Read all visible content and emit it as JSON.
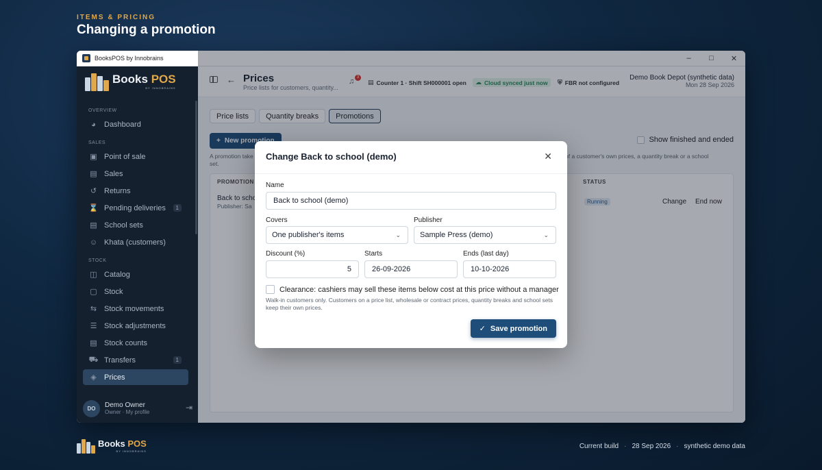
{
  "header": {
    "kicker": "ITEMS & PRICING",
    "title": "Changing a promotion"
  },
  "window": {
    "title": "BooksPOS by Innobrains",
    "controls": [
      "minimize-icon",
      "maximize-icon",
      "close-icon"
    ]
  },
  "brand": {
    "books": "Books",
    "pos": "POS",
    "sub": "BY INNOBRAINS",
    "color_accent": "#e0a84a"
  },
  "sidebar": {
    "sections": {
      "overview": "OVERVIEW",
      "sales": "SALES",
      "stock": "STOCK"
    },
    "items": [
      {
        "label": "Dashboard",
        "icon": "gauge-icon"
      },
      {
        "label": "Point of sale",
        "icon": "scan-icon"
      },
      {
        "label": "Sales",
        "icon": "receipt-icon"
      },
      {
        "label": "Returns",
        "icon": "undo-icon"
      },
      {
        "label": "Pending deliveries",
        "icon": "hourglass-icon",
        "badge": "1"
      },
      {
        "label": "School sets",
        "icon": "backpack-icon"
      },
      {
        "label": "Khata (customers)",
        "icon": "users-icon"
      },
      {
        "label": "Catalog",
        "icon": "book-icon"
      },
      {
        "label": "Stock",
        "icon": "box-icon"
      },
      {
        "label": "Stock movements",
        "icon": "arrows-icon"
      },
      {
        "label": "Stock adjustments",
        "icon": "sliders-icon"
      },
      {
        "label": "Stock counts",
        "icon": "clipboard-icon"
      },
      {
        "label": "Transfers",
        "icon": "truck-icon",
        "badge": "1"
      },
      {
        "label": "Prices",
        "icon": "tag-icon",
        "active": true
      }
    ],
    "user": {
      "initials": "DO",
      "name": "Demo Owner",
      "sub": "Owner · My profile"
    }
  },
  "topbar": {
    "title": "Prices",
    "subtitle": "Price lists for customers, quantity...",
    "notifications": "3",
    "counter": "Counter 1 · Shift SH000001 open",
    "cloud": "Cloud synced just now",
    "fbr": "FBR not configured",
    "org": "Demo Book Depot (synthetic data)",
    "date": "Mon 28 Sep 2026"
  },
  "tabs": [
    "Price lists",
    "Quantity breaks",
    "Promotions"
  ],
  "toolbar": {
    "new_label": "New promotion",
    "show_finished": "Show finished and ended",
    "hint_left": "A promotion take set.",
    "hint_right": "of a customer's own prices, a quantity break or a school"
  },
  "table": {
    "headers": {
      "promotion": "PROMOTION",
      "status": "STATUS"
    },
    "rows": [
      {
        "name": "Back to scho",
        "sub": "Publisher: Sa",
        "status": "Running",
        "change": "Change",
        "end": "End now"
      }
    ]
  },
  "modal": {
    "title": "Change Back to school (demo)",
    "name_label": "Name",
    "name_value": "Back to school (demo)",
    "covers_label": "Covers",
    "covers_value": "One publisher's items",
    "publisher_label": "Publisher",
    "publisher_value": "Sample Press (demo)",
    "discount_label": "Discount (%)",
    "discount_value": "5",
    "starts_label": "Starts",
    "starts_value": "26-09-2026",
    "ends_label": "Ends (last day)",
    "ends_value": "10-10-2026",
    "clearance_label": "Clearance: cashiers may sell these items below cost at this price without a manager",
    "clearance_checked": false,
    "clearance_hint": "Walk-in customers only. Customers on a price list, wholesale or contract prices, quantity breaks and school sets keep their own prices.",
    "save_label": "Save promotion"
  },
  "footer": {
    "build": "Current build",
    "date": "28 Sep 2026",
    "data": "synthetic demo data"
  }
}
